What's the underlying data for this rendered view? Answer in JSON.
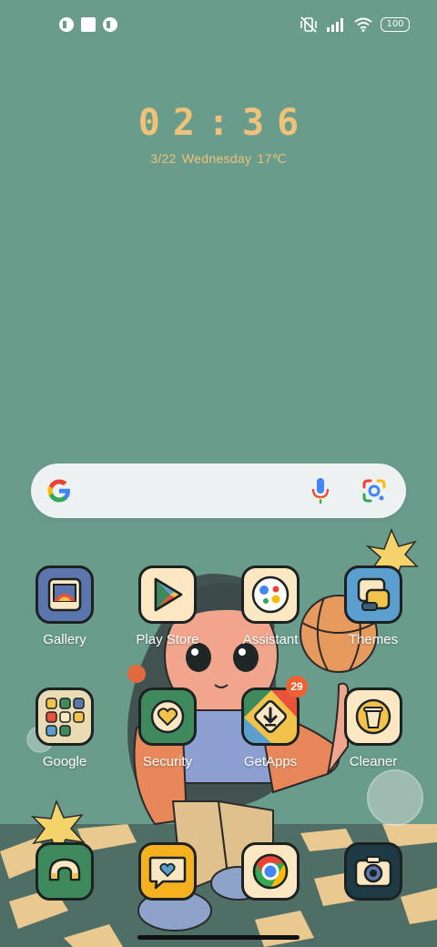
{
  "status_bar": {
    "notification_icons": [
      "app-notification-icon",
      "square-notification-icon",
      "app-notification-icon"
    ],
    "silent_icon": "vibrate-off-icon",
    "signal_icon": "cellular-signal-icon",
    "wifi_icon": "wifi-icon",
    "battery_level": "100"
  },
  "clock": {
    "time": "02:36",
    "date": "3/22",
    "weekday": "Wednesday",
    "temperature": "17℃"
  },
  "search": {
    "logo_icon": "google-g-icon",
    "voice_icon": "microphone-icon",
    "lens_icon": "google-lens-icon"
  },
  "apps": {
    "row1": [
      {
        "label": "Gallery",
        "icon": "gallery-icon",
        "tile_color": "#5b75ad"
      },
      {
        "label": "Play Store",
        "icon": "play-store-icon",
        "tile_color": "#fbe7c1"
      },
      {
        "label": "Assistant",
        "icon": "assistant-icon",
        "tile_color": "#fbe7c1"
      },
      {
        "label": "Themes",
        "icon": "themes-icon",
        "tile_color": "#5a9fcf"
      }
    ],
    "row2": [
      {
        "label": "Google",
        "icon": "google-folder-icon",
        "tile_color": "#e9dbb3"
      },
      {
        "label": "Security",
        "icon": "security-heart-icon",
        "tile_color": "#3e8a5c"
      },
      {
        "label": "GetApps",
        "icon": "getapps-icon",
        "tile_color": "#f0c24a",
        "badge": "29"
      },
      {
        "label": "Cleaner",
        "icon": "cleaner-icon",
        "tile_color": "#fbe7c1"
      }
    ],
    "dock": [
      {
        "icon": "phone-icon",
        "tile_color": "#3e8a5c"
      },
      {
        "icon": "messaging-icon",
        "tile_color": "#f5b21e"
      },
      {
        "icon": "chrome-icon",
        "tile_color": "#fbe7c1"
      },
      {
        "icon": "camera-icon",
        "tile_color": "#1e3a44"
      }
    ]
  },
  "colors": {
    "background": "#6a9c8c",
    "clock": "#efc279",
    "badge": "#ee6133"
  }
}
